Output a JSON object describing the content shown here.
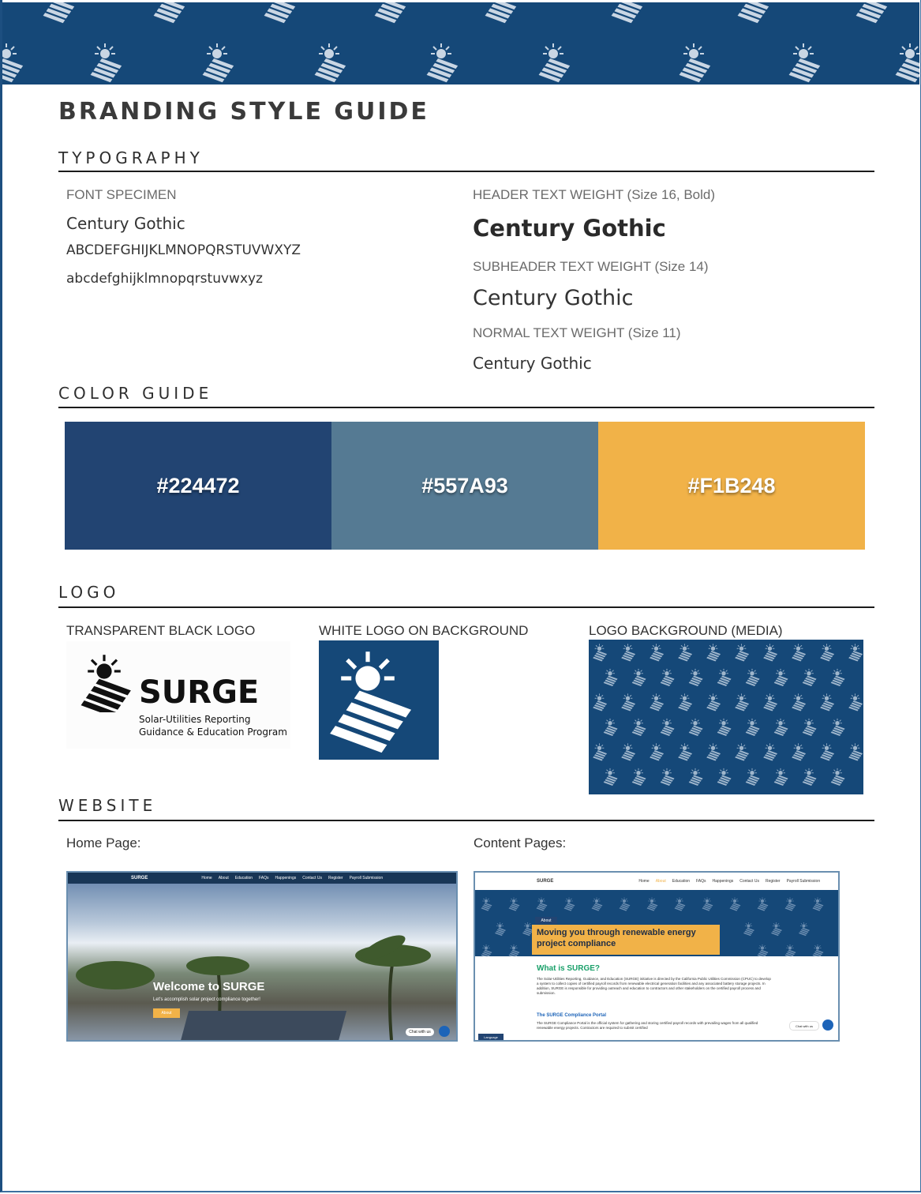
{
  "title": "BRANDING STYLE GUIDE",
  "sections": {
    "typography": "TYPOGRAPHY",
    "color_guide": "COLOR GUIDE",
    "logo": "LOGO",
    "website": "WEBSITE"
  },
  "typography": {
    "specimen_label": "FONT SPECIMEN",
    "specimen_name": "Century Gothic",
    "uppercase": "ABCDEFGHIJKLMNOPQRSTUVWXYZ",
    "lowercase": "abcdefghijklmnopqrstuvwxyz",
    "header_label": "HEADER TEXT WEIGHT (Size 16, Bold)",
    "header_sample": "Century Gothic",
    "subheader_label": "SUBHEADER TEXT WEIGHT (Size 14)",
    "subheader_sample": "Century Gothic",
    "normal_label": "NORMAL TEXT WEIGHT (Size 11)",
    "normal_sample": "Century Gothic"
  },
  "colors": [
    {
      "hex": "#224472",
      "label": "#224472"
    },
    {
      "hex": "#557A93",
      "label": "#557A93"
    },
    {
      "hex": "#F1B248",
      "label": "#F1B248"
    }
  ],
  "logo": {
    "transparent_label": "TRANSPARENT BLACK LOGO",
    "white_label": "WHITE LOGO ON BACKGROUND",
    "background_label": "LOGO BACKGROUND (MEDIA)",
    "wordmark": "SURGE",
    "tagline_1": "Solar-Utilities Reporting",
    "tagline_2": "Guidance & Education Program"
  },
  "website": {
    "home_label": "Home Page:",
    "content_label": "Content Pages:",
    "home": {
      "logo": "SURGE",
      "nav": [
        "Home",
        "About",
        "Education",
        "FAQs",
        "Happenings",
        "Contact Us",
        "Register",
        "Payroll Submission"
      ],
      "welcome": "Welcome to SURGE",
      "sub": "Let's accomplish solar project compliance together!",
      "button": "About",
      "chat": "Chat with us"
    },
    "content": {
      "logo": "SURGE",
      "nav": [
        "Home",
        "About",
        "Education",
        "FAQs",
        "Happenings",
        "Contact Us",
        "Register",
        "Payroll Submission"
      ],
      "tag": "About",
      "banner": "Moving you through renewable energy project compliance",
      "what_heading": "What is SURGE?",
      "what_body": "The Solar-Utilities Reporting, Guidance, and Education (SURGE) initiative is directed by the California Public Utilities Commission (CPUC) to develop a system to collect copies of certified payroll records from renewable electrical generation facilities and any associated battery storage projects. In addition, SURGE is responsible for providing outreach and education to contractors and other stakeholders on the certified payroll process and submission.",
      "portal_heading": "The SURGE Compliance Portal",
      "portal_body": "The SURGE Compliance Portal is the official system for gathering and storing certified payroll records with prevailing wages from all qualified renewable energy projects. Contractors are required to submit certified",
      "chat": "Chat with us",
      "language": "Language"
    }
  }
}
